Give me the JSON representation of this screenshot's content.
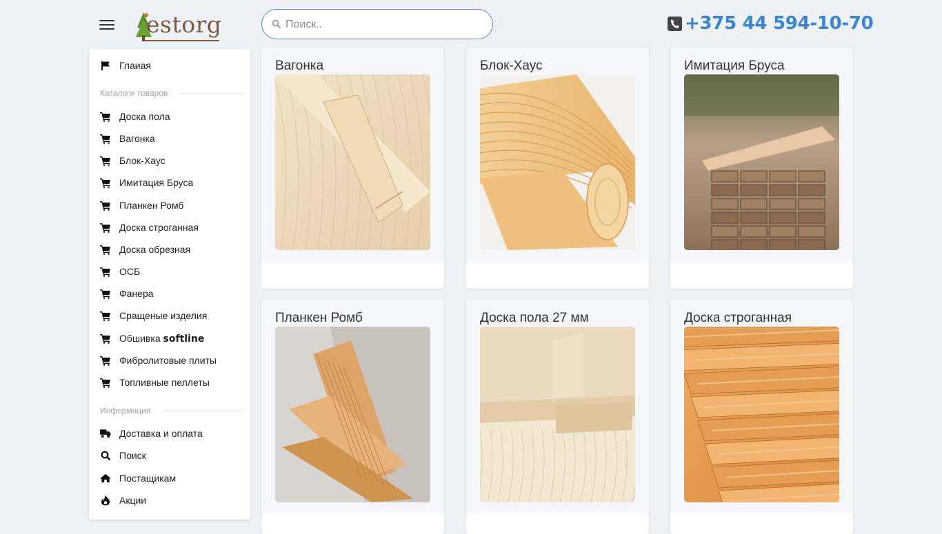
{
  "header": {
    "logo_text": "estorg",
    "search_placeholder": "Поиск..",
    "phone": "+375 44 594-10-70"
  },
  "sidebar": {
    "home": "Глаиая",
    "catalog_title": "Каталоги товаров",
    "catalog": [
      "Доска пола",
      "Вагонка",
      "Блок-Хаус",
      "Имитация Бруса",
      "Планкен Ромб",
      "Доска строганная",
      "Доска обрезная",
      "ОСБ",
      "Фанера",
      "Сращеные изделия",
      "Обшивка",
      "Фибролитовые плиты",
      "Топливные пеллеты"
    ],
    "softline": "softline",
    "info_title": "Информация",
    "info": [
      {
        "label": "Доставка и оплата",
        "icon": "truck-icon"
      },
      {
        "label": "Поиск",
        "icon": "search-icon"
      },
      {
        "label": "Постащикам",
        "icon": "home-icon"
      },
      {
        "label": "Акции",
        "icon": "fire-icon"
      }
    ]
  },
  "products": [
    {
      "title": "Вагонка"
    },
    {
      "title": "Блок-Хаус"
    },
    {
      "title": "Имитация Бруса"
    },
    {
      "title": "Планкен Ромб"
    },
    {
      "title": "Доска пола 27 мм"
    },
    {
      "title": "Доска строганная"
    }
  ],
  "colors": {
    "accent": "#3a86d6",
    "background": "#eef1f5",
    "wood_light": "#e8d2b0",
    "wood_warm": "#e0a560"
  }
}
